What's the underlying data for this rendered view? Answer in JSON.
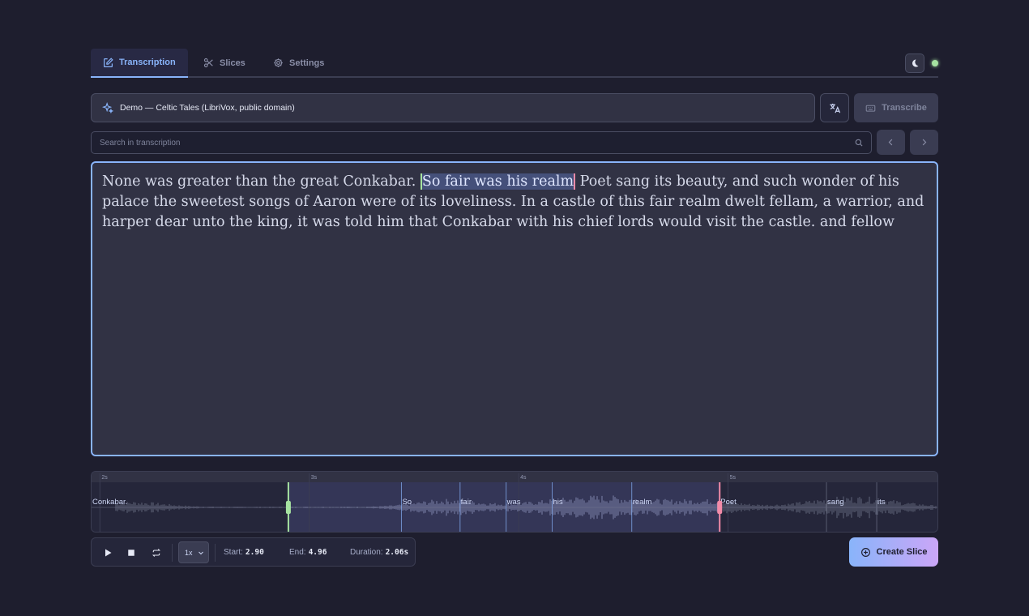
{
  "tabs": [
    {
      "label": "Transcription",
      "icon": "edit-icon",
      "active": true
    },
    {
      "label": "Slices",
      "icon": "scissors-icon",
      "active": false
    },
    {
      "label": "Settings",
      "icon": "gear-icon",
      "active": false
    }
  ],
  "header": {
    "theme_icon": "moon-icon",
    "status_color": "#a6e3a1"
  },
  "source": {
    "label": "Demo — Celtic Tales (LibriVox, public domain)",
    "icon": "sparkle-icon"
  },
  "toolbar": {
    "translate_icon": "translate-icon",
    "transcribe_label": "Transcribe"
  },
  "search": {
    "placeholder": "Search in transcription",
    "value": ""
  },
  "transcript": {
    "before": "None was greater than the great Conkabar. ",
    "selected": "So fair was his realm",
    "after": " Poet sang its beauty, and such wonder of his palace the sweetest songs of Aaron were of its loveliness. In a castle of this fair realm dwelt fellam, a warrior, and harper dear unto the king, it was told him that Conkabar with his chief lords would visit the castle. and fellow"
  },
  "timeline": {
    "view_start": 1.96,
    "view_end": 6.0,
    "ticks": [
      {
        "label": "2s",
        "t": 2
      },
      {
        "label": "3s",
        "t": 3
      },
      {
        "label": "4s",
        "t": 4
      },
      {
        "label": "5s",
        "t": 5
      }
    ],
    "words": [
      {
        "text": "Conkabar.",
        "t": 1.96
      },
      {
        "text": "So",
        "t": 3.44
      },
      {
        "text": "fair",
        "t": 3.72
      },
      {
        "text": "was",
        "t": 3.94
      },
      {
        "text": "his",
        "t": 4.16
      },
      {
        "text": "realm",
        "t": 4.54
      },
      {
        "text": "Poet",
        "t": 4.96
      },
      {
        "text": "sang",
        "t": 5.47
      },
      {
        "text": "its",
        "t": 5.71
      }
    ],
    "selection_start": 2.9,
    "selection_end": 4.96
  },
  "controls": {
    "speed": "1x",
    "start_label": "Start:",
    "start_value": "2.90",
    "end_label": "End:",
    "end_value": "4.96",
    "duration_label": "Duration:",
    "duration_value": "2.06s"
  },
  "create_slice": {
    "label": "Create Slice"
  },
  "colors": {
    "accent": "#89b4fa",
    "start_marker": "#a6e3a1",
    "end_marker": "#f38ba8"
  }
}
